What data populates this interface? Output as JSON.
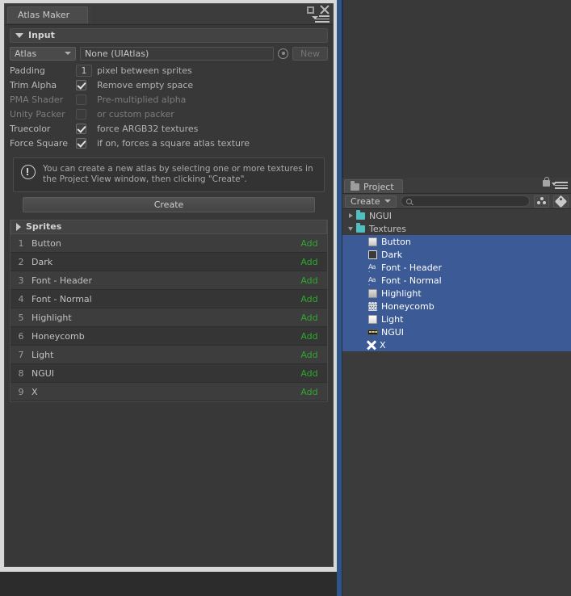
{
  "window": {
    "tab_label": "Atlas Maker",
    "maximize_icon": "maximize-icon",
    "close_icon": "close-icon",
    "menu_icon": "panel-menu-icon"
  },
  "input_section": {
    "foldout_label": "Input",
    "atlas_row": {
      "dropdown_label": "Atlas",
      "object_value": "None (UIAtlas)",
      "picker_icon": "object-picker-icon",
      "new_button": "New"
    },
    "fields": [
      {
        "label": "Padding",
        "control": "number",
        "value": "1",
        "checked": false,
        "description": "pixel between sprites",
        "dim": false
      },
      {
        "label": "Trim Alpha",
        "control": "checkbox",
        "value": "",
        "checked": true,
        "description": "Remove empty space",
        "dim": false
      },
      {
        "label": "PMA Shader",
        "control": "checkbox",
        "value": "",
        "checked": false,
        "description": "Pre-multiplied alpha",
        "dim": true
      },
      {
        "label": "Unity Packer",
        "control": "checkbox",
        "value": "",
        "checked": false,
        "description": "or custom packer",
        "dim": true
      },
      {
        "label": "Truecolor",
        "control": "checkbox",
        "value": "",
        "checked": true,
        "description": "force ARGB32 textures",
        "dim": false
      },
      {
        "label": "Force Square",
        "control": "checkbox",
        "value": "",
        "checked": true,
        "description": "if on, forces a square atlas texture",
        "dim": false
      }
    ],
    "help": {
      "icon": "info-icon",
      "text": "You can create a new atlas by selecting one or more textures in the Project View window, then clicking \"Create\"."
    },
    "create_button": "Create"
  },
  "sprites_section": {
    "foldout_label": "Sprites",
    "action_label": "Add",
    "action_color": "#2ea82e",
    "rows": [
      {
        "index": "1",
        "name": "Button"
      },
      {
        "index": "2",
        "name": "Dark"
      },
      {
        "index": "3",
        "name": "Font - Header"
      },
      {
        "index": "4",
        "name": "Font - Normal"
      },
      {
        "index": "5",
        "name": "Highlight"
      },
      {
        "index": "6",
        "name": "Honeycomb"
      },
      {
        "index": "7",
        "name": "Light"
      },
      {
        "index": "8",
        "name": "NGUI"
      },
      {
        "index": "9",
        "name": "X"
      }
    ]
  },
  "project_panel": {
    "tab_label": "Project",
    "tab_icon": "folder-icon",
    "lock_icon": "lock-icon",
    "menu_icon": "panel-menu-icon",
    "toolbar": {
      "create_label": "Create",
      "search_placeholder": "",
      "search_value": "",
      "search_icon": "search-icon",
      "filter_type_icon": "filter-by-type-icon",
      "filter_label_icon": "filter-by-label-icon"
    },
    "tree": [
      {
        "label": "NGUI",
        "depth": 0,
        "arrow": "right",
        "icon": "folder-icon",
        "selected": false
      },
      {
        "label": "Textures",
        "depth": 0,
        "arrow": "down",
        "icon": "folder-icon",
        "selected": false
      },
      {
        "label": "Button",
        "depth": 1,
        "arrow": "none",
        "icon": "texture-button-icon",
        "selected": true
      },
      {
        "label": "Dark",
        "depth": 1,
        "arrow": "none",
        "icon": "texture-dark-icon",
        "selected": true
      },
      {
        "label": "Font - Header",
        "depth": 1,
        "arrow": "none",
        "icon": "texture-font-icon",
        "selected": true
      },
      {
        "label": "Font - Normal",
        "depth": 1,
        "arrow": "none",
        "icon": "texture-font-icon",
        "selected": true
      },
      {
        "label": "Highlight",
        "depth": 1,
        "arrow": "none",
        "icon": "texture-highlight-icon",
        "selected": true
      },
      {
        "label": "Honeycomb",
        "depth": 1,
        "arrow": "none",
        "icon": "texture-honeycomb-icon",
        "selected": true
      },
      {
        "label": "Light",
        "depth": 1,
        "arrow": "none",
        "icon": "texture-light-icon",
        "selected": true
      },
      {
        "label": "NGUI",
        "depth": 1,
        "arrow": "none",
        "icon": "texture-ngui-icon",
        "selected": true
      },
      {
        "label": "X",
        "depth": 1,
        "arrow": "none",
        "icon": "texture-x-icon",
        "selected": true
      }
    ]
  },
  "colors": {
    "selection_blue": "#3c5a96",
    "accent_strip": "#2f5488",
    "panel_bg": "#383838",
    "add_green": "#2ea82e"
  }
}
